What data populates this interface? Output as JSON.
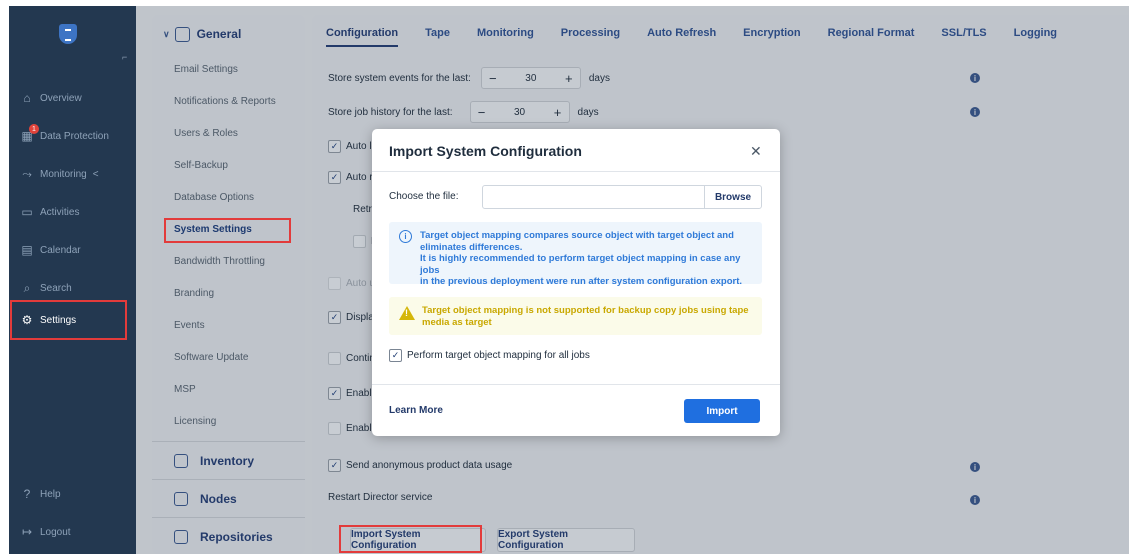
{
  "nav": {
    "items": [
      {
        "label": "Overview",
        "icon": "home-icon",
        "glyph": "⌂"
      },
      {
        "label": "Data Protection",
        "icon": "data-protection-icon",
        "glyph": "▦",
        "badge": "1"
      },
      {
        "label": "Monitoring",
        "icon": "monitoring-icon",
        "glyph": "⤳",
        "suffix": "<"
      },
      {
        "label": "Activities",
        "icon": "activities-icon",
        "glyph": "▭"
      },
      {
        "label": "Calendar",
        "icon": "calendar-icon",
        "glyph": "▤"
      },
      {
        "label": "Search",
        "icon": "search-icon",
        "glyph": "⌕"
      },
      {
        "label": "Settings",
        "icon": "gear-icon",
        "glyph": "⚙"
      }
    ],
    "help": "Help",
    "logout": "Logout"
  },
  "side": {
    "general": "General",
    "links": [
      "Email Settings",
      "Notifications & Reports",
      "Users & Roles",
      "Self-Backup",
      "Database Options",
      "System Settings",
      "Bandwidth Throttling",
      "Branding",
      "Events",
      "Software Update",
      "MSP",
      "Licensing"
    ],
    "inventory": "Inventory",
    "nodes": "Nodes",
    "repositories": "Repositories"
  },
  "tabs": [
    "Configuration",
    "Tape",
    "Monitoring",
    "Processing",
    "Auto Refresh",
    "Encryption",
    "Regional Format",
    "SSL/TLS",
    "Logging"
  ],
  "form": {
    "events_label": "Store system events for the last:",
    "events_value": "30",
    "history_label": "Store job history for the last:",
    "history_value": "30",
    "unit": "days",
    "auto_lo": "Auto lo",
    "auto_r": "Auto r",
    "retry": "Retry i",
    "r": "R",
    "auto_u": "Auto u",
    "display": "Displa",
    "contin": "Contin",
    "enable1": "Enable",
    "enable2": "Enable",
    "send": "Send anonymous product data usage",
    "restart": "Restart Director service",
    "import_btn": "Import System Configuration",
    "export_btn": "Export System Configuration"
  },
  "dialog": {
    "title": "Import System Configuration",
    "file_label": "Choose the file:",
    "file_value": "",
    "browse": "Browse",
    "info_lines": [
      "Target object mapping compares source object with target object and",
      "eliminates differences.",
      "It is highly recommended to perform target object mapping in case any jobs",
      "in the previous deployment were run after system configuration export."
    ],
    "warn_lines": [
      "Target object mapping is not supported for backup copy jobs using tape",
      "media as target"
    ],
    "checkbox_label": "Perform target object mapping for all jobs",
    "learn_more": "Learn More",
    "import": "Import"
  }
}
